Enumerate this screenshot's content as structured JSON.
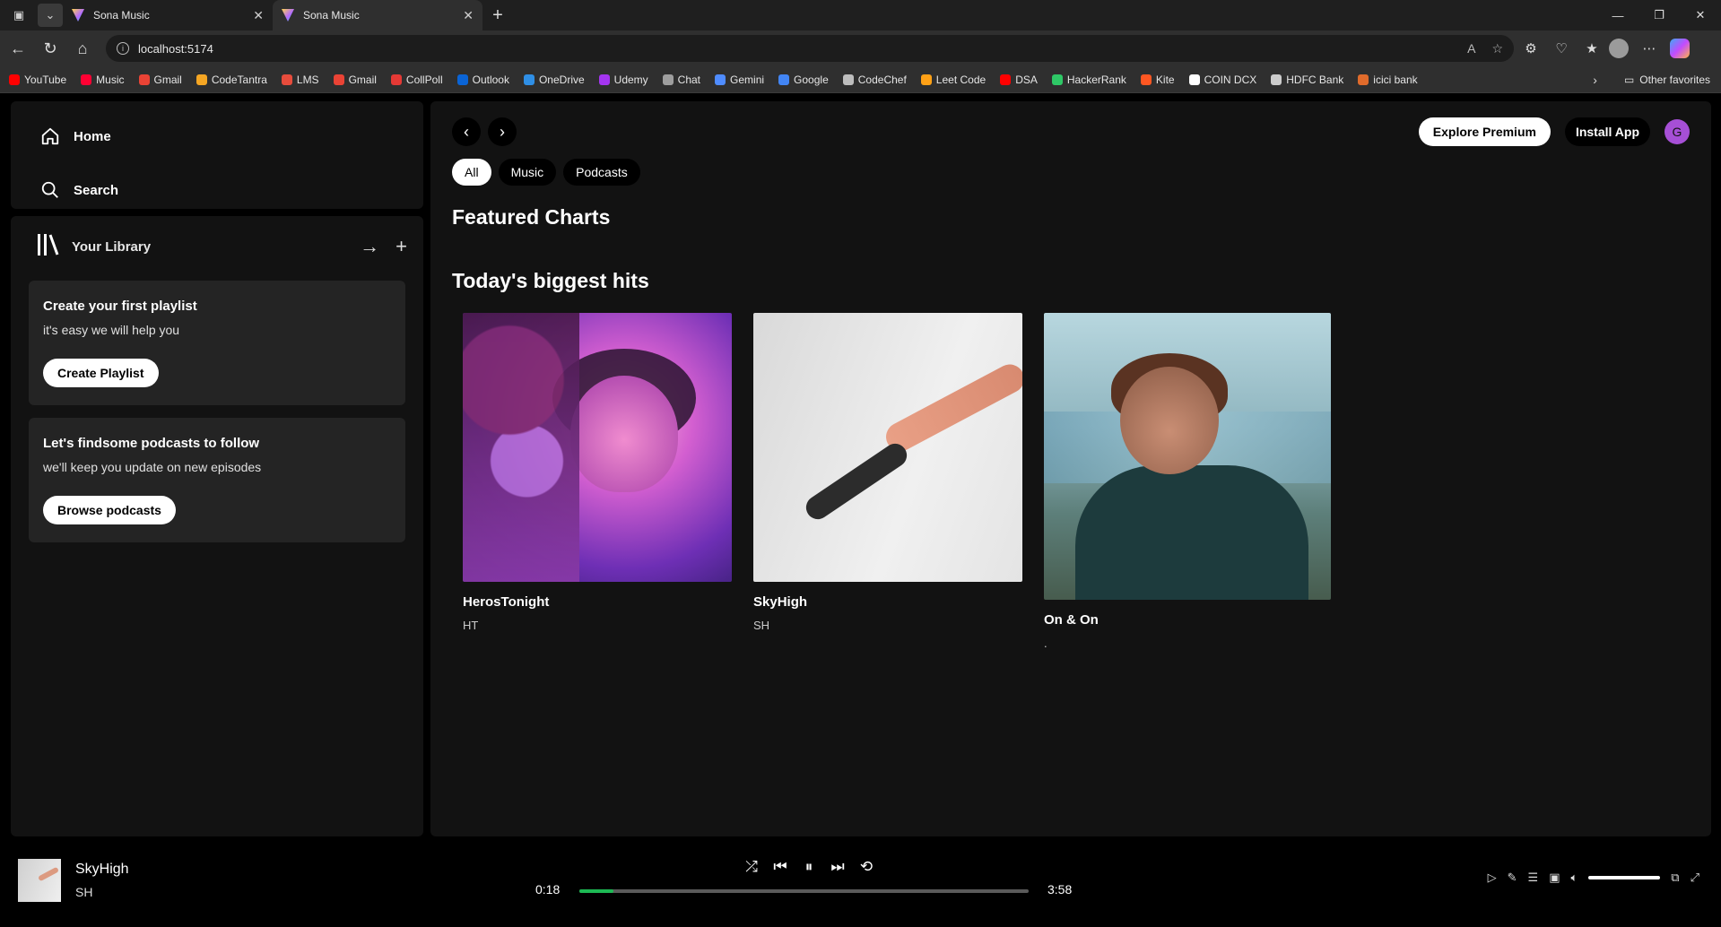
{
  "browser": {
    "tabs": [
      {
        "title": "Sona Music",
        "active": false
      },
      {
        "title": "Sona Music",
        "active": true
      }
    ],
    "url": "localhost:5174",
    "bookmarks": [
      {
        "label": "YouTube",
        "color": "#ff0000"
      },
      {
        "label": "Music",
        "color": "#ff0033"
      },
      {
        "label": "Gmail",
        "color": "#ea4335"
      },
      {
        "label": "CodeTantra",
        "color": "#f5a623"
      },
      {
        "label": "LMS",
        "color": "#e74c3c"
      },
      {
        "label": "Gmail",
        "color": "#ea4335"
      },
      {
        "label": "CollPoll",
        "color": "#e53935"
      },
      {
        "label": "Outlook",
        "color": "#0a64d6"
      },
      {
        "label": "OneDrive",
        "color": "#2f8fe6"
      },
      {
        "label": "Udemy",
        "color": "#a435f0"
      },
      {
        "label": "Chat",
        "color": "#9e9e9e"
      },
      {
        "label": "Gemini",
        "color": "#4f8cff"
      },
      {
        "label": "Google",
        "color": "#4285f4"
      },
      {
        "label": "CodeChef",
        "color": "#bdbdbd"
      },
      {
        "label": "Leet Code",
        "color": "#ffa116"
      },
      {
        "label": "DSA",
        "color": "#ff0000"
      },
      {
        "label": "HackerRank",
        "color": "#2ec866"
      },
      {
        "label": "Kite",
        "color": "#ff5722"
      },
      {
        "label": "COIN DCX",
        "color": "#ffffff"
      },
      {
        "label": "HDFC Bank",
        "color": "#cccccc"
      },
      {
        "label": "icici bank",
        "color": "#e06b2b"
      }
    ],
    "other_favorites": "Other favorites"
  },
  "sidebar": {
    "home": "Home",
    "search": "Search",
    "library": "Your Library",
    "cards": [
      {
        "title": "Create your first playlist",
        "subtitle": "it's easy we will help you",
        "button": "Create Playlist"
      },
      {
        "title": "Let's findsome podcasts to follow",
        "subtitle": "we'll keep you update on new episodes",
        "button": "Browse podcasts"
      }
    ]
  },
  "header": {
    "explore_premium": "Explore Premium",
    "install_app": "Install App",
    "user_initial": "G"
  },
  "filters": [
    "All",
    "Music",
    "Podcasts"
  ],
  "main": {
    "featured_title": "Featured Charts",
    "hits_title": "Today's biggest hits",
    "albums": [
      {
        "name": "HerosTonight",
        "artist": "HT"
      },
      {
        "name": "SkyHigh",
        "artist": "SH"
      },
      {
        "name": "On & On",
        "artist": "."
      }
    ]
  },
  "player": {
    "title": "SkyHigh",
    "artist": "SH",
    "elapsed": "0:18",
    "duration": "3:58",
    "progress": 0.075,
    "volume": 1.0
  },
  "colors": {
    "accent": "#1db954",
    "panel": "#121212",
    "card": "#242424",
    "avatar": "#a64fd6"
  }
}
